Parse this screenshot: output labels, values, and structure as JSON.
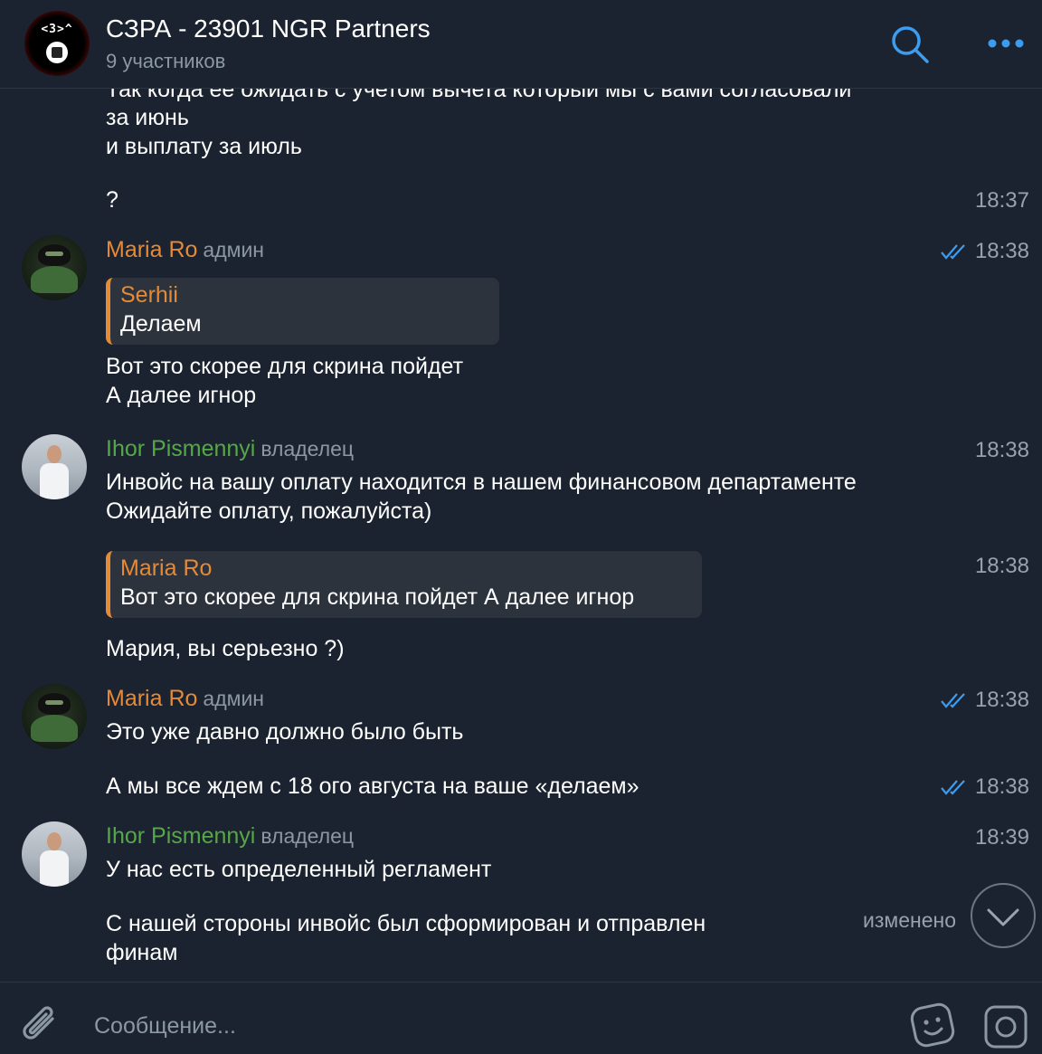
{
  "header": {
    "avatar_text": "<3>^",
    "title": "СЗРА - 23901 NGR Partners",
    "subtitle": "9 участников",
    "search_icon": "search-icon",
    "more_icon": "more-dots-icon",
    "accent_color": "#3b9cf0"
  },
  "messages": [
    {
      "id": "m1",
      "lines": [
        "Так когда ее ожидать с учетом вычета который мы с вами согласовали",
        "за июнь",
        "и выплату за июль"
      ]
    },
    {
      "id": "m2",
      "text": "?",
      "time": "18:37"
    },
    {
      "id": "m3",
      "sender": "Maria Ro",
      "role": "админ",
      "time": "18:38",
      "read": true,
      "reply": {
        "name": "Serhii",
        "text": "Делаем"
      },
      "lines": [
        "Вот это скорее для скрина пойдет",
        "А далее игнор"
      ]
    },
    {
      "id": "m4",
      "sender": "Ihor Pismennyi",
      "role": "владелец",
      "time": "18:38",
      "lines": [
        "Инвойс на вашу оплату находится в нашем финансовом департаменте",
        "Ожидайте оплату, пожалуйста)"
      ]
    },
    {
      "id": "m5",
      "time": "18:38",
      "reply": {
        "name": "Maria Ro",
        "text": "Вот это скорее для скрина пойдет  А далее игнор"
      },
      "text": "Мария, вы серьезно ?)"
    },
    {
      "id": "m6",
      "sender": "Maria Ro",
      "role": "админ",
      "time": "18:38",
      "read": true,
      "text": "Это уже давно должно было быть"
    },
    {
      "id": "m7",
      "time": "18:38",
      "read": true,
      "text": "А мы все ждем с 18 ого августа на ваше «делаем»"
    },
    {
      "id": "m8",
      "sender": "Ihor Pismennyi",
      "role": "владелец",
      "time": "18:39",
      "text": "У нас есть определенный регламент"
    },
    {
      "id": "m9",
      "lines": [
        "С нашей стороны инвойс был сформирован и отправлен",
        "финам"
      ],
      "edited": "изменено"
    }
  ],
  "colors": {
    "admin_name": "#e58a37",
    "owner_name": "#56a747",
    "background": "#1b2330",
    "read_check": "#3b9cf0"
  },
  "input": {
    "placeholder": "Сообщение...",
    "attach_icon": "paperclip-icon",
    "sticker_icon": "sticker-icon",
    "camera_icon": "camera-icon"
  },
  "scroll_down_icon": "chevron-down-icon"
}
